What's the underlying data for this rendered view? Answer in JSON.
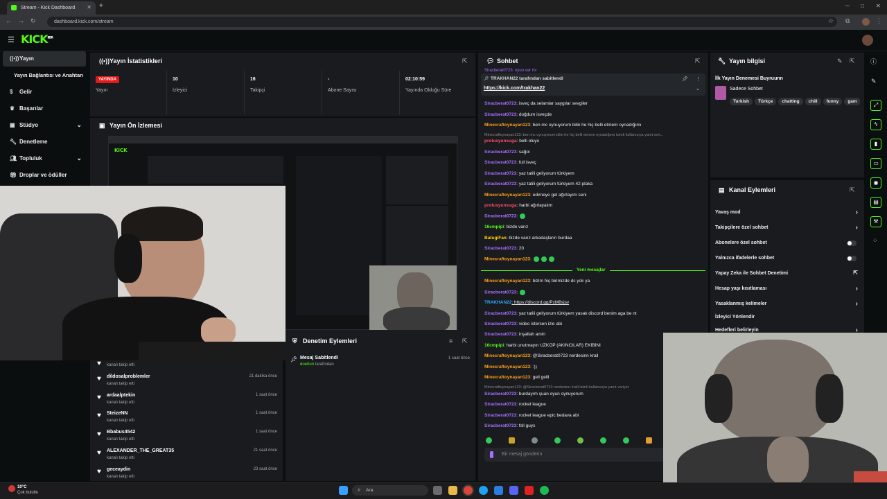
{
  "browser": {
    "tab_title": "Stream - Kick Dashboard",
    "url": "dashboard.kick.com/stream",
    "new_tab": "+"
  },
  "brand": {
    "logo": "KICK",
    "beta": "BETA",
    "accent": "#53fc18"
  },
  "sidebar": {
    "items": [
      {
        "label": "Yayın",
        "icon": "broadcast-icon"
      },
      {
        "label": "Yayın Bağlantısı ve Anahtarı",
        "icon": ""
      },
      {
        "label": "Gelir",
        "icon": "dollar-icon"
      },
      {
        "label": "Başarılar",
        "icon": "trophy-icon"
      },
      {
        "label": "Stüdyo",
        "icon": "grid-icon"
      },
      {
        "label": "Denetleme",
        "icon": "wrench-icon"
      },
      {
        "label": "Topluluk",
        "icon": "people-icon"
      },
      {
        "label": "Droplar ve ödüller",
        "icon": "gift-icon"
      }
    ]
  },
  "stats": {
    "title": "Yayın İstatistikleri",
    "live": "YAYINDA",
    "items": [
      {
        "value": "",
        "label": "Yayın"
      },
      {
        "value": "10",
        "label": "İzleyici"
      },
      {
        "value": "16",
        "label": "Takipçi"
      },
      {
        "value": "-",
        "label": "Abone Sayısı"
      },
      {
        "value": "02:10:59",
        "label": "Yayında Olduğu Süre"
      }
    ]
  },
  "preview": {
    "title": "Yayın Ön İzlemesi"
  },
  "followers": [
    {
      "name": "",
      "sub": "kanalı takip etti",
      "time": ""
    },
    {
      "name": "dildosalproblemler",
      "sub": "kanalı takip etti",
      "time": "21 dakika önce"
    },
    {
      "name": "ardaalptekin",
      "sub": "kanalı takip etti",
      "time": "1 saat önce"
    },
    {
      "name": "SteizeNN",
      "sub": "kanalı takip etti",
      "time": "1 saat önce"
    },
    {
      "name": "Bbabus4542",
      "sub": "kanalı takip etti",
      "time": "1 saat önce"
    },
    {
      "name": "ALEXANDER_THE_GREAT35",
      "sub": "kanalı takip etti",
      "time": "21 saat önce"
    },
    {
      "name": "geceaydin",
      "sub": "kanalı takip etti",
      "time": "23 saat önce"
    }
  ],
  "modactions": {
    "title": "Denetim Eylemleri",
    "item_title": "Mesaj Sabitlendi",
    "item_user": "doerlun",
    "item_suffix": " tarafından",
    "item_time": "1 saat önce"
  },
  "chat": {
    "title": "Sohbet",
    "pinned_by": "TRAKHAN22 tarafından sabitlendi",
    "pinned_link": "https://kick.com/trakhan22",
    "top_cut": "Siracberat0723: oyun var mı",
    "new_messages": "Yeni mesajlar",
    "placeholder": "Bir mesaj gönderin",
    "messages": [
      {
        "user": "Siracberat0723",
        "color": "#a970ff",
        "text": ": isveç da selamlar saygılar sevgiler"
      },
      {
        "user": "Siracberat0723",
        "color": "#a970ff",
        "text": ": doğdum isveçde"
      },
      {
        "user": "Minecraftoynayan123",
        "color": "#ff9f1a",
        "text": ": ben mc oynuyorum bilin he hiç belli etmem oynadığımı"
      },
      {
        "user": "prolusyunsuga",
        "color": "#ff4d6a",
        "text": ": belli oluyo"
      },
      {
        "user": "Siracberat0723",
        "color": "#a970ff",
        "text": ": sağol"
      },
      {
        "user": "Siracberat0723",
        "color": "#a970ff",
        "text": ": full isveç"
      },
      {
        "user": "Siracberat0723",
        "color": "#a970ff",
        "text": ": yaz tatili geliyorum türkiyem"
      },
      {
        "user": "Siracberat0723",
        "color": "#a970ff",
        "text": ": yaz tatili geliyorum türkiyem 42 plaka"
      },
      {
        "user": "Minecraftoynayan123",
        "color": "#ff9f1a",
        "text": ": edirneye gel ağırlayım seni"
      },
      {
        "user": "prolusyunsuga",
        "color": "#ff4d6a",
        "text": ": harbi ağırlayalım"
      },
      {
        "user": "Siracberat0723",
        "color": "#a970ff",
        "text": ":"
      },
      {
        "user": "16cmpipi",
        "color": "#53fc18",
        "text": ": bizde varız"
      },
      {
        "user": "BatugiFan",
        "color": "#ffd400",
        "text": ": bizde varız arkadaşların burdaa"
      },
      {
        "user": "Siracberat0723",
        "color": "#a970ff",
        "text": ": 20"
      },
      {
        "user": "Minecraftoynayan123",
        "color": "#ff9f1a",
        "text": ":"
      }
    ],
    "reply1": "Minecraftoynayan123: ben mc oynuyorum bilin he hiç belli etmem oynadığımı isimli kullanıcıya yanıt veri...",
    "messages2": [
      {
        "user": "Minecraftoynayan123",
        "color": "#ff9f1a",
        "text": ": bizim hiç birimizde dc yok ya"
      },
      {
        "user": "Siracberat0723",
        "color": "#a970ff",
        "text": ":"
      },
      {
        "user": "TRAKHAN22",
        "color": "#2ea8ff",
        "text": ": https://discord.gg/PzM8sjsv"
      },
      {
        "user": "Siracberat0723",
        "color": "#a970ff",
        "text": ": yaz tatili geliyorum türkiyem yasak discord benim aga be nt"
      },
      {
        "user": "Siracberat0723",
        "color": "#a970ff",
        "text": ": video istersen izle abi"
      },
      {
        "user": "Siracberat0723",
        "color": "#a970ff",
        "text": ": inşallah amin"
      },
      {
        "user": "16cmpipi",
        "color": "#53fc18",
        "text": ": harbi unutmayın UZKÖP (AKINCILAR) EKİBİNİ"
      },
      {
        "user": "Minecraftoynayan123",
        "color": "#ff9f1a",
        "text": ": @Siracberat0723 nerdesinn krall"
      },
      {
        "user": "Minecraftoynayan123",
        "color": "#ff9f1a",
        "text": ": :))"
      },
      {
        "user": "Minecraftoynayan123",
        "color": "#ff9f1a",
        "text": ": gell gelll"
      }
    ],
    "reply2": "Minecraftoynayan123: @Siracberat0723 nerdesinn krall isimli kullanıcıya yanıt veriyor",
    "messages3": [
      {
        "user": "Siracberat0723",
        "color": "#a970ff",
        "text": ": burdayım şuan oyun oynuyorum"
      },
      {
        "user": "Siracberat0723",
        "color": "#a970ff",
        "text": ": rocket league"
      },
      {
        "user": "Siracberat0723",
        "color": "#a970ff",
        "text": ": rocket league epic bedava abi"
      },
      {
        "user": "Siracberat0723",
        "color": "#a970ff",
        "text": ": fsll guys"
      }
    ]
  },
  "info": {
    "title": "Yayın bilgisi",
    "stream_title": "İlk Yayın Denemesi Buyruunn",
    "category": "Sadece Sohbet",
    "tags": [
      "Turkish",
      "Türkçe",
      "chatting",
      "chill",
      "funny",
      "gam"
    ]
  },
  "channel_actions": {
    "title": "Kanal Eylemleri",
    "rows": [
      {
        "label": "Yavaş mod",
        "kind": "chev"
      },
      {
        "label": "Takipçilere özel sohbet",
        "kind": "chev"
      },
      {
        "label": "Abonelere özel sohbet",
        "kind": "toggle"
      },
      {
        "label": "Yalnızca ifadelerle sohbet",
        "kind": "toggle"
      },
      {
        "label": "Yapay Zeka ile Sohbet Denetimi",
        "kind": "ext"
      },
      {
        "label": "Hesap yaşı kısıtlaması",
        "kind": "chev"
      },
      {
        "label": "Yasaklanmış kelimeler",
        "kind": "chev"
      },
      {
        "label": "İzleyici Yönlendir",
        "kind": "none"
      },
      {
        "label": "Hedefleri belirleyin",
        "kind": "chev"
      }
    ]
  },
  "taskbar": {
    "weather_temp": "10°C",
    "weather_desc": "Çok bulutlu",
    "search": "Ara"
  }
}
